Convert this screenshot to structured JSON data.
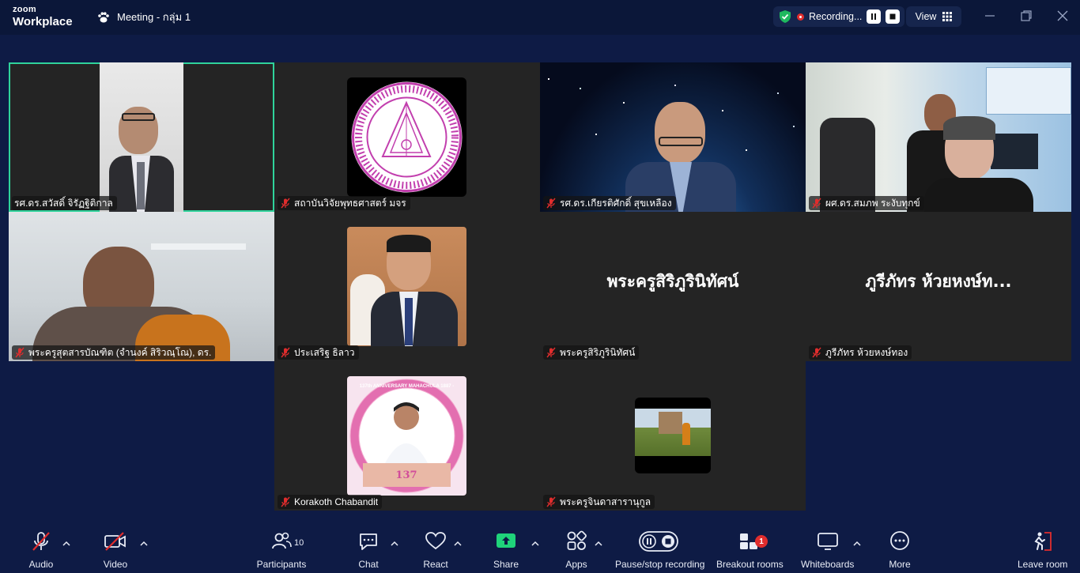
{
  "app": {
    "brand_top": "zoom",
    "brand_bottom": "Workplace",
    "meeting_title": "Meeting - กลุ่ม 1"
  },
  "recording": {
    "label": "Recording...",
    "view_label": "View"
  },
  "colors": {
    "background": "#0e1b45",
    "titlebar": "#0b1739",
    "tile": "#242424",
    "active_speaker": "#2fd39b",
    "share_green": "#1fd37a",
    "muted_red": "#e02d2d"
  },
  "participants": [
    {
      "name": "รศ.ดร.สวัสดิ์ จิรัฏฐิติกาล",
      "muted": false,
      "active": true,
      "media": "video"
    },
    {
      "name": "สถาบันวิจัยพุทธศาสตร์ มจร",
      "muted": true,
      "media": "seal-logo"
    },
    {
      "name": "รศ.ดร.เกียรติศักดิ์ สุขเหลือง",
      "muted": true,
      "media": "video-space-background"
    },
    {
      "name": "ผศ.ดร.สมภพ  ระงับทุกข์",
      "muted": true,
      "media": "video-office"
    },
    {
      "name": "พระครูสุตสารบัณฑิต (จำนงค์ สิริวณฺโณ), ดร.",
      "muted": true,
      "media": "video-monk"
    },
    {
      "name": "ประเสริฐ ธิลาว",
      "muted": true,
      "media": "profile-photo"
    },
    {
      "name": "พระครูสิริภูรินิทัศน์",
      "display_name": "พระครูสิริภูรินิทัศน์",
      "muted": true,
      "media": "name-only"
    },
    {
      "name": "ภูรีภัทร ห้วยหงษ์ทอง",
      "display_name": "ภูรีภัทร ห้วยหงษ์ท...",
      "muted": true,
      "media": "name-only"
    },
    {
      "name": "Korakoth Chabandit",
      "muted": true,
      "media": "anniversary-profile",
      "photo_text": "137th ANNIVERSARY MAHACHULA 1887 - 2024",
      "photo_number": "137"
    },
    {
      "name": "พระครูจินดาสารานุกูล",
      "muted": true,
      "media": "profile-photo-small"
    }
  ],
  "toolbar": {
    "audio": "Audio",
    "video": "Video",
    "participants": "Participants",
    "participants_count": "10",
    "chat": "Chat",
    "react": "React",
    "share": "Share",
    "apps": "Apps",
    "record": "Pause/stop recording",
    "breakout": "Breakout rooms",
    "breakout_badge": "1",
    "whiteboards": "Whiteboards",
    "more": "More",
    "leave": "Leave room"
  }
}
